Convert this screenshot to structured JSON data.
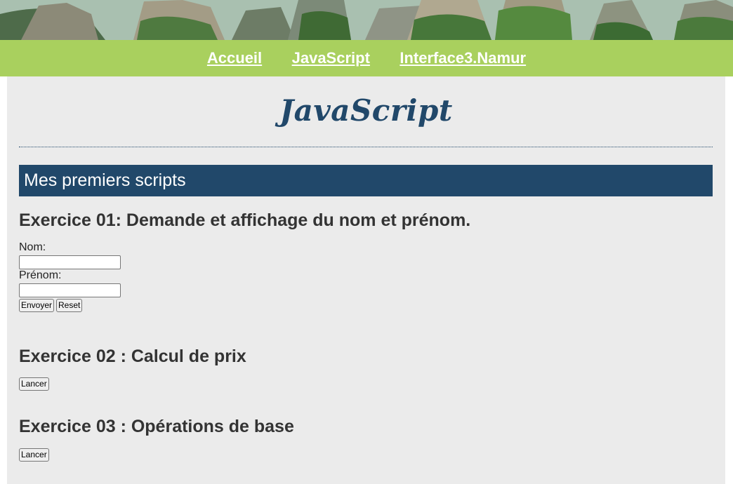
{
  "nav": {
    "items": [
      {
        "label": "Accueil"
      },
      {
        "label": "JavaScript"
      },
      {
        "label": "Interface3.Namur"
      }
    ]
  },
  "header": {
    "title": "JavaScript"
  },
  "section": {
    "title": "Mes premiers scripts"
  },
  "exercises": [
    {
      "title": "Exercice 01: Demande et affichage du nom et prénom.",
      "form": {
        "nom_label": "Nom:",
        "nom_value": "",
        "prenom_label": "Prénom:",
        "prenom_value": "",
        "submit_label": "Envoyer",
        "reset_label": "Reset"
      }
    },
    {
      "title": "Exercice 02 : Calcul de prix",
      "button_label": "Lancer"
    },
    {
      "title": "Exercice 03 : Opérations de base",
      "button_label": "Lancer"
    }
  ],
  "colors": {
    "nav_bg": "#a9d05e",
    "accent": "#21486a",
    "page_bg": "#ebebeb"
  }
}
